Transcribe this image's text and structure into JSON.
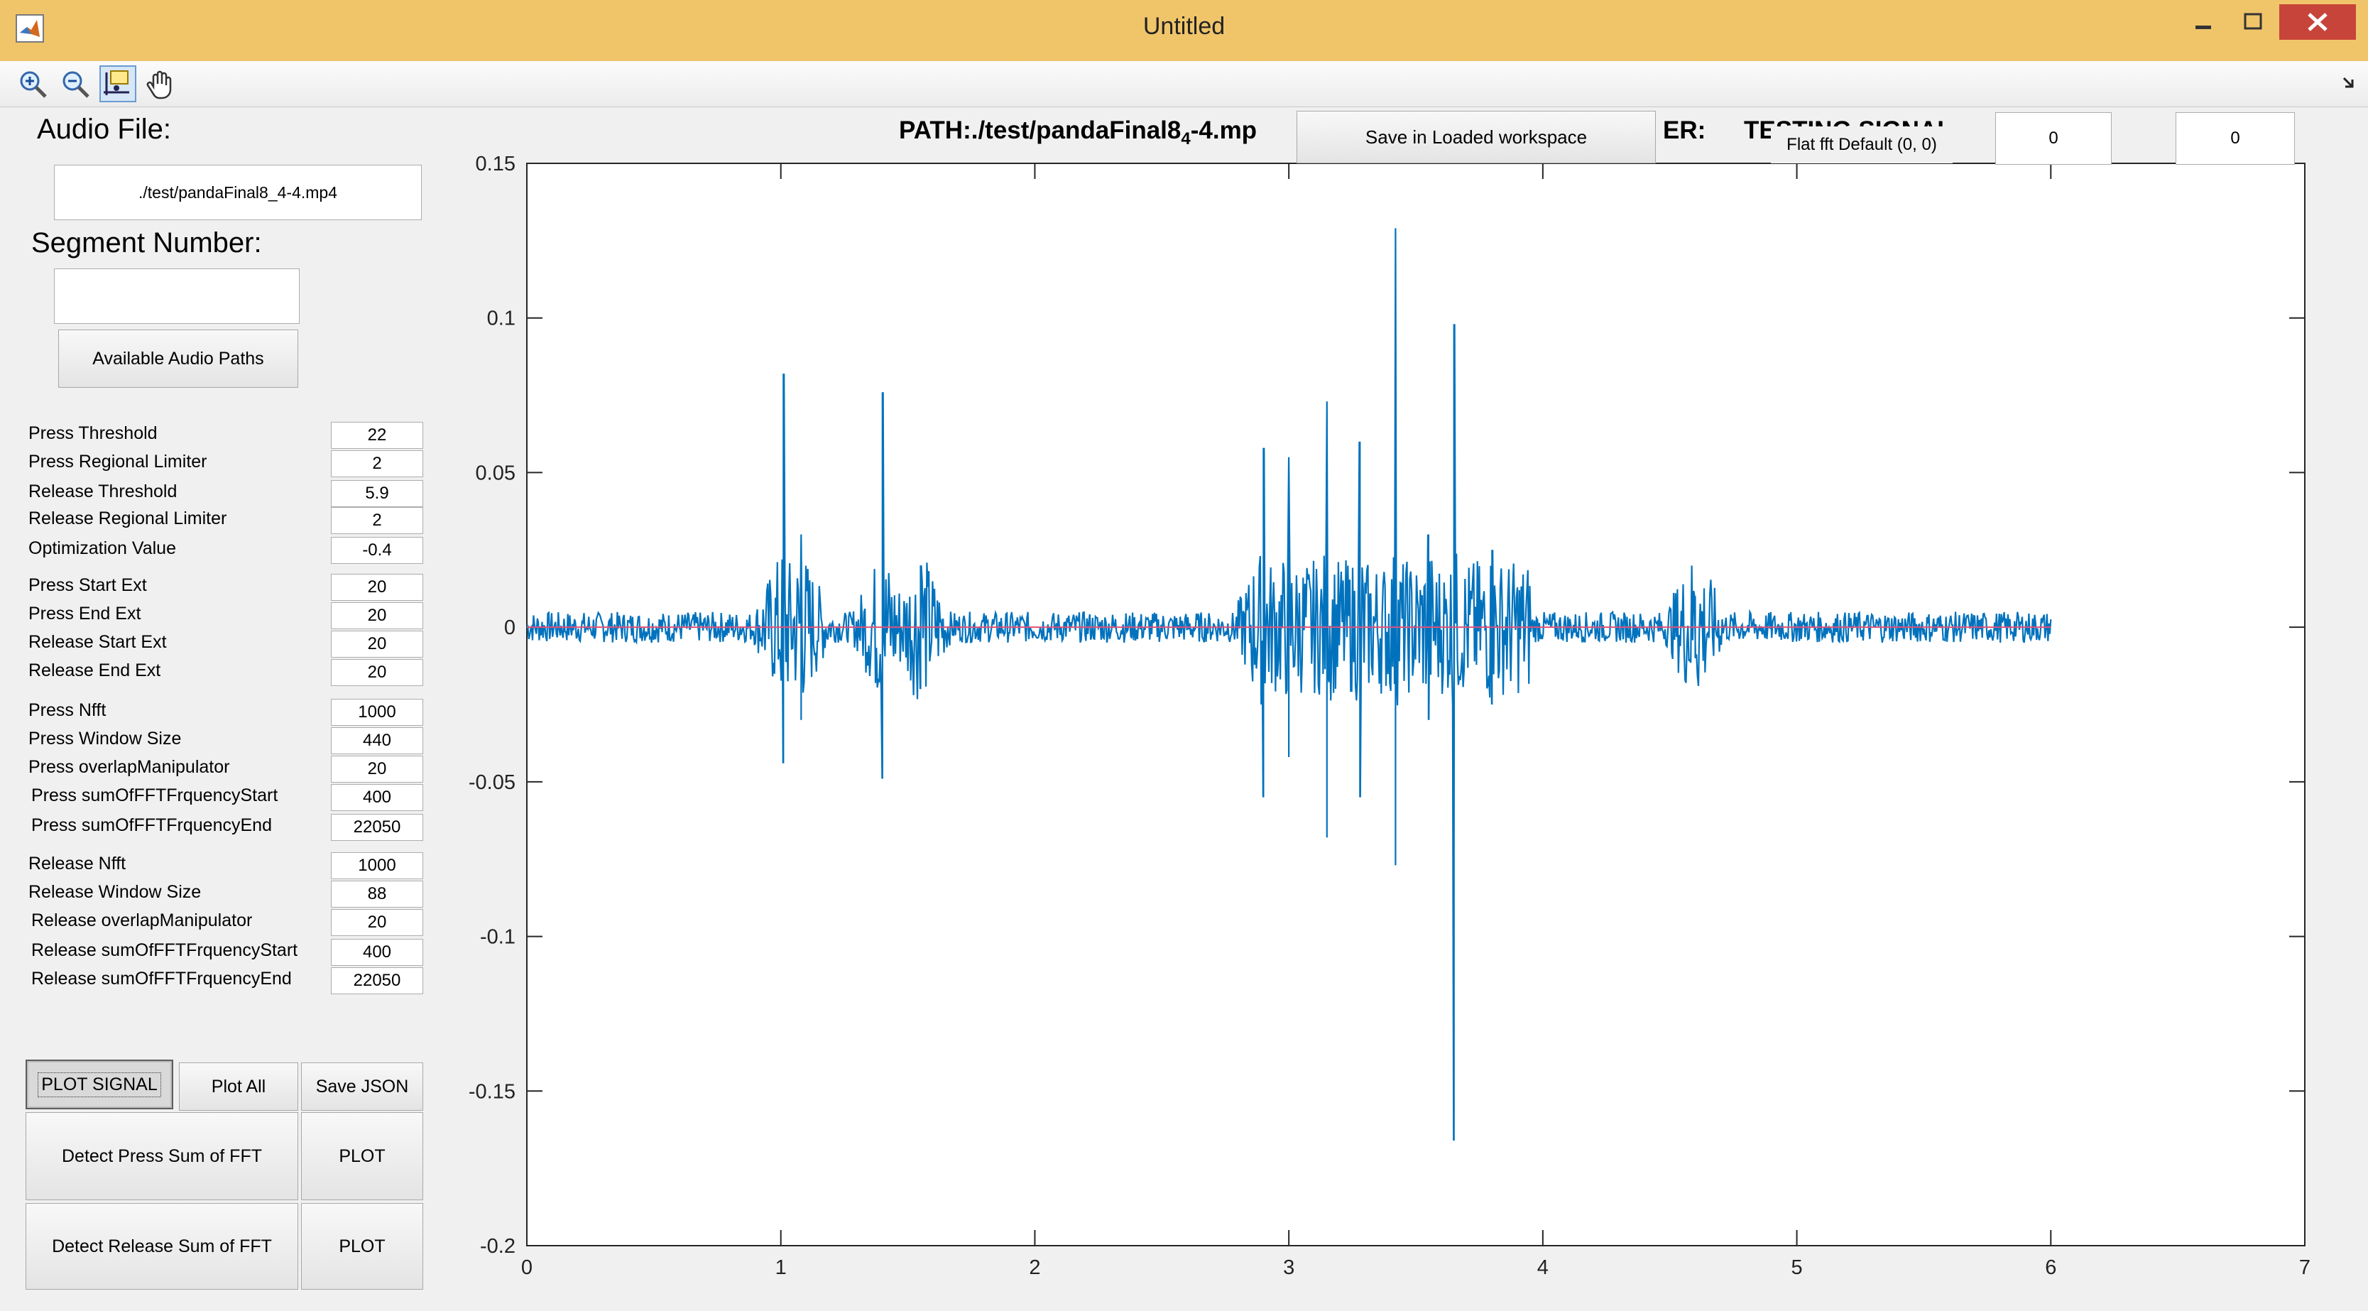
{
  "window": {
    "title": "Untitled"
  },
  "panel": {
    "audio_file_label": "Audio File:",
    "audio_file_value": "./test/pandaFinal8_4-4.mp4",
    "segment_label": "Segment Number:",
    "segment_value": "",
    "available_paths_button": "Available Audio Paths",
    "params": [
      {
        "label": "Press Threshold",
        "value": "22"
      },
      {
        "label": "Press Regional Limiter",
        "value": "2"
      },
      {
        "label": "Release Threshold",
        "value": "5.9"
      },
      {
        "label": "Release Regional Limiter",
        "value": "2"
      },
      {
        "label": "Optimization Value",
        "value": "-0.4"
      },
      {
        "label": "Press Start Ext",
        "value": "20"
      },
      {
        "label": "Press End Ext",
        "value": "20"
      },
      {
        "label": "Release Start Ext",
        "value": "20"
      },
      {
        "label": "Release End Ext",
        "value": "20"
      },
      {
        "label": "Press Nfft",
        "value": "1000"
      },
      {
        "label": "Press Window Size",
        "value": "440"
      },
      {
        "label": "Press overlapManipulator",
        "value": "20"
      },
      {
        "label": "Press sumOfFFTFrquencyStart",
        "value": "400"
      },
      {
        "label": "Press sumOfFFTFrquencyEnd",
        "value": "22050"
      },
      {
        "label": "Release Nfft",
        "value": "1000"
      },
      {
        "label": "Release Window Size",
        "value": "88"
      },
      {
        "label": "Release overlapManipulator",
        "value": "20"
      },
      {
        "label": "Release sumOfFFTFrquencyStart",
        "value": "400"
      },
      {
        "label": "Release sumOfFFTFrquencyEnd",
        "value": "22050"
      }
    ],
    "buttons": {
      "plot_signal": "PLOT SIGNAL",
      "plot_all": "Plot All",
      "save_json": "Save JSON",
      "detect_press": "Detect Press Sum of FFT",
      "plot_press": "PLOT",
      "detect_release": "Detect Release Sum of FFT",
      "plot_release": "PLOT"
    }
  },
  "header": {
    "path_prefix": "PATH:./test/pandaFinal8",
    "path_sub": "4",
    "path_suffix": "-4.mp",
    "save_workspace_button": "Save in Loaded workspace",
    "er_label": "ER:",
    "testing_signal": "TESTING SIGNAL",
    "flat_fft_label": "Flat fft Default (0, 0)",
    "input_a": "0",
    "input_b": "0"
  },
  "colors": {
    "signal": "#0072bd",
    "baseline": "#e0507a",
    "titlebar": "#f0c56a"
  },
  "chart_data": {
    "type": "line",
    "title": "",
    "xlabel": "",
    "ylabel": "",
    "xlim": [
      0,
      7
    ],
    "ylim": [
      -0.2,
      0.15
    ],
    "xticks": [
      0,
      1,
      2,
      3,
      4,
      5,
      6,
      7
    ],
    "yticks": [
      0.15,
      0.1,
      0.05,
      0,
      -0.05,
      -0.1,
      -0.15,
      -0.2
    ],
    "xtick_labels": [
      "0",
      "1",
      "2",
      "3",
      "4",
      "5",
      "6",
      "7"
    ],
    "ytick_labels": [
      "0.15",
      "0.1",
      "0.05",
      "0",
      "-0.05",
      "-0.1",
      "-0.15",
      "-0.2"
    ],
    "grid": false,
    "series": [
      {
        "x_start": 0,
        "x_end": 6,
        "noise_amplitude": 0.005,
        "peaks": [
          {
            "x": 1.01,
            "max": 0.082,
            "min": -0.044
          },
          {
            "x": 1.08,
            "max": 0.03,
            "min": -0.03
          },
          {
            "x": 1.4,
            "max": 0.076,
            "min": -0.049
          },
          {
            "x": 1.55,
            "max": 0.02,
            "min": -0.02
          },
          {
            "x": 2.9,
            "max": 0.058,
            "min": -0.055
          },
          {
            "x": 3.0,
            "max": 0.055,
            "min": -0.042
          },
          {
            "x": 3.15,
            "max": 0.073,
            "min": -0.068
          },
          {
            "x": 3.28,
            "max": 0.06,
            "min": -0.055
          },
          {
            "x": 3.42,
            "max": 0.129,
            "min": -0.077
          },
          {
            "x": 3.55,
            "max": 0.03,
            "min": -0.03
          },
          {
            "x": 3.65,
            "max": 0.098,
            "min": -0.166
          },
          {
            "x": 3.8,
            "max": 0.025,
            "min": -0.025
          },
          {
            "x": 4.6,
            "max": 0.01,
            "min": -0.01
          }
        ]
      },
      {
        "name": "",
        "constant": 0,
        "x_start": 0,
        "x_end": 6
      }
    ]
  }
}
